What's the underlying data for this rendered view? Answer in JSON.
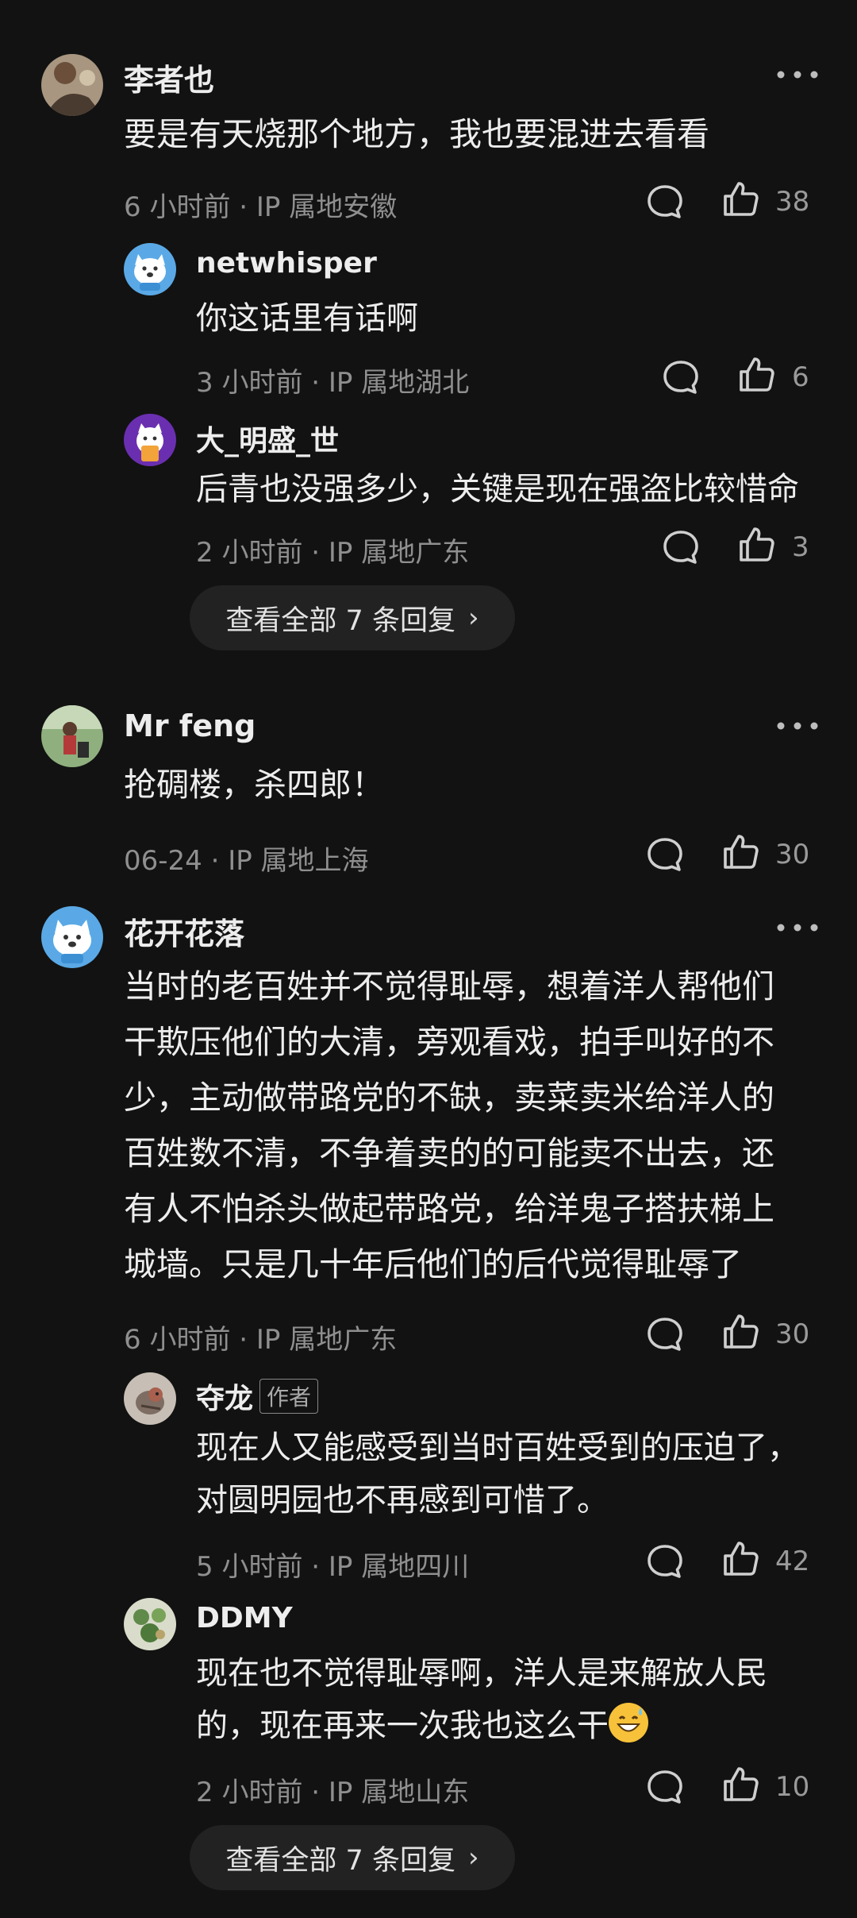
{
  "comments": [
    {
      "name": "李者也",
      "text": "要是有天烧那个地方，我也要混进去看看",
      "meta": "6 小时前 · IP 属地安徽",
      "likes": "38",
      "replies": [
        {
          "name": "netwhisper",
          "text": "你这话里有话啊",
          "meta": "3 小时前 · IP 属地湖北",
          "likes": "6"
        },
        {
          "name": "大_明盛_世",
          "text": "后青也没强多少，关键是现在强盗比较惜命",
          "meta": "2 小时前 · IP 属地广东",
          "likes": "3"
        }
      ],
      "view_all": "查看全部 7 条回复"
    },
    {
      "name": "Mr feng",
      "text": "抢碉楼，杀四郎！",
      "meta": "06-24 · IP 属地上海",
      "likes": "30"
    },
    {
      "name": "花开花落",
      "text_lines": [
        "当时的老百姓并不觉得耻辱，想着洋人帮他们",
        "干欺压他们的大清，旁观看戏，拍手叫好的不",
        "少，主动做带路党的不缺，卖菜卖米给洋人的",
        "百姓数不清，不争着卖的的可能卖不出去，还",
        "有人不怕杀头做起带路党，给洋鬼子搭扶梯上",
        "城墙。只是几十年后他们的后代觉得耻辱了"
      ],
      "meta": "6 小时前 · IP 属地广东",
      "likes": "30",
      "replies": [
        {
          "name": "夺龙",
          "badge": "作者",
          "text_lines": [
            "现在人又能感受到当时百姓受到的压迫了，",
            "对圆明园也不再感到可惜了。"
          ],
          "meta": "5 小时前 · IP 属地四川",
          "likes": "42"
        },
        {
          "name": "DDMY",
          "text_lines": [
            "现在也不觉得耻辱啊，洋人是来解放人民",
            "的，现在再来一次我也这么干"
          ],
          "meta": "2 小时前 · IP 属地山东",
          "likes": "10"
        }
      ],
      "view_all": "查看全部 7 条回复"
    }
  ],
  "icons": {
    "reply": "comment-bubble-icon",
    "like": "thumbs-up-icon",
    "more": "more-dots-icon",
    "chevron": "›",
    "emoji": "grinning-sweat-emoji-icon"
  },
  "colors": {
    "background": "#121212",
    "text": "#ededed",
    "meta": "#8f8f8f",
    "pill": "#222222"
  }
}
